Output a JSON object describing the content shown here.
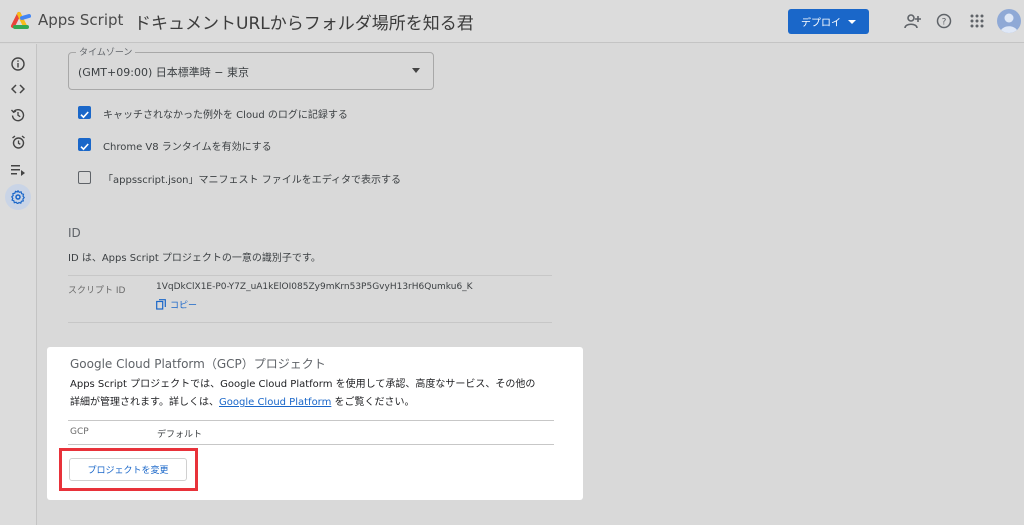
{
  "header": {
    "app_name": "Apps Script",
    "project_title": "ドキュメントURLからフォルダ場所を知る君",
    "deploy_label": "デプロイ",
    "icons": [
      "add-person-icon",
      "help-icon",
      "apps-grid-icon",
      "avatar"
    ],
    "brand_color": "#1a67c9"
  },
  "rail": {
    "icons": [
      "info-icon",
      "code-icon",
      "history-icon",
      "alarm-icon",
      "executions-icon",
      "settings-icon"
    ],
    "active": "settings-icon"
  },
  "timezone": {
    "legend": "タイムゾーン",
    "value": "(GMT+09:00) 日本標準時 − 東京"
  },
  "checkboxes": [
    {
      "label": "キャッチされなかった例外を Cloud のログに記録する",
      "checked": true
    },
    {
      "label": "Chrome V8 ランタイムを有効にする",
      "checked": true
    },
    {
      "label": "「appsscript.json」マニフェスト ファイルをエディタで表示する",
      "checked": false
    }
  ],
  "id_section": {
    "heading": "ID",
    "description": "ID は、Apps Script プロジェクトの一意の識別子です。",
    "script_id_label": "スクリプト ID",
    "script_id_value": "1VqDkClX1E-P0-Y7Z_uA1kElOI085Zy9mKrn53P5GvyH13rH6Qumku6_K",
    "copy_label": "コピー"
  },
  "gcp": {
    "title": "Google Cloud Platform（GCP）プロジェクト",
    "desc_line1": "Apps Script プロジェクトでは、Google Cloud Platform を使用して承認、高度なサービス、その他の",
    "desc_line2_prefix": "詳細が管理されます。詳しくは、",
    "desc_link": "Google Cloud Platform",
    "desc_line2_suffix": " をご覧ください。",
    "key_label": "GCP",
    "key_value": "デフォルト",
    "change_button": "プロジェクトを変更"
  }
}
